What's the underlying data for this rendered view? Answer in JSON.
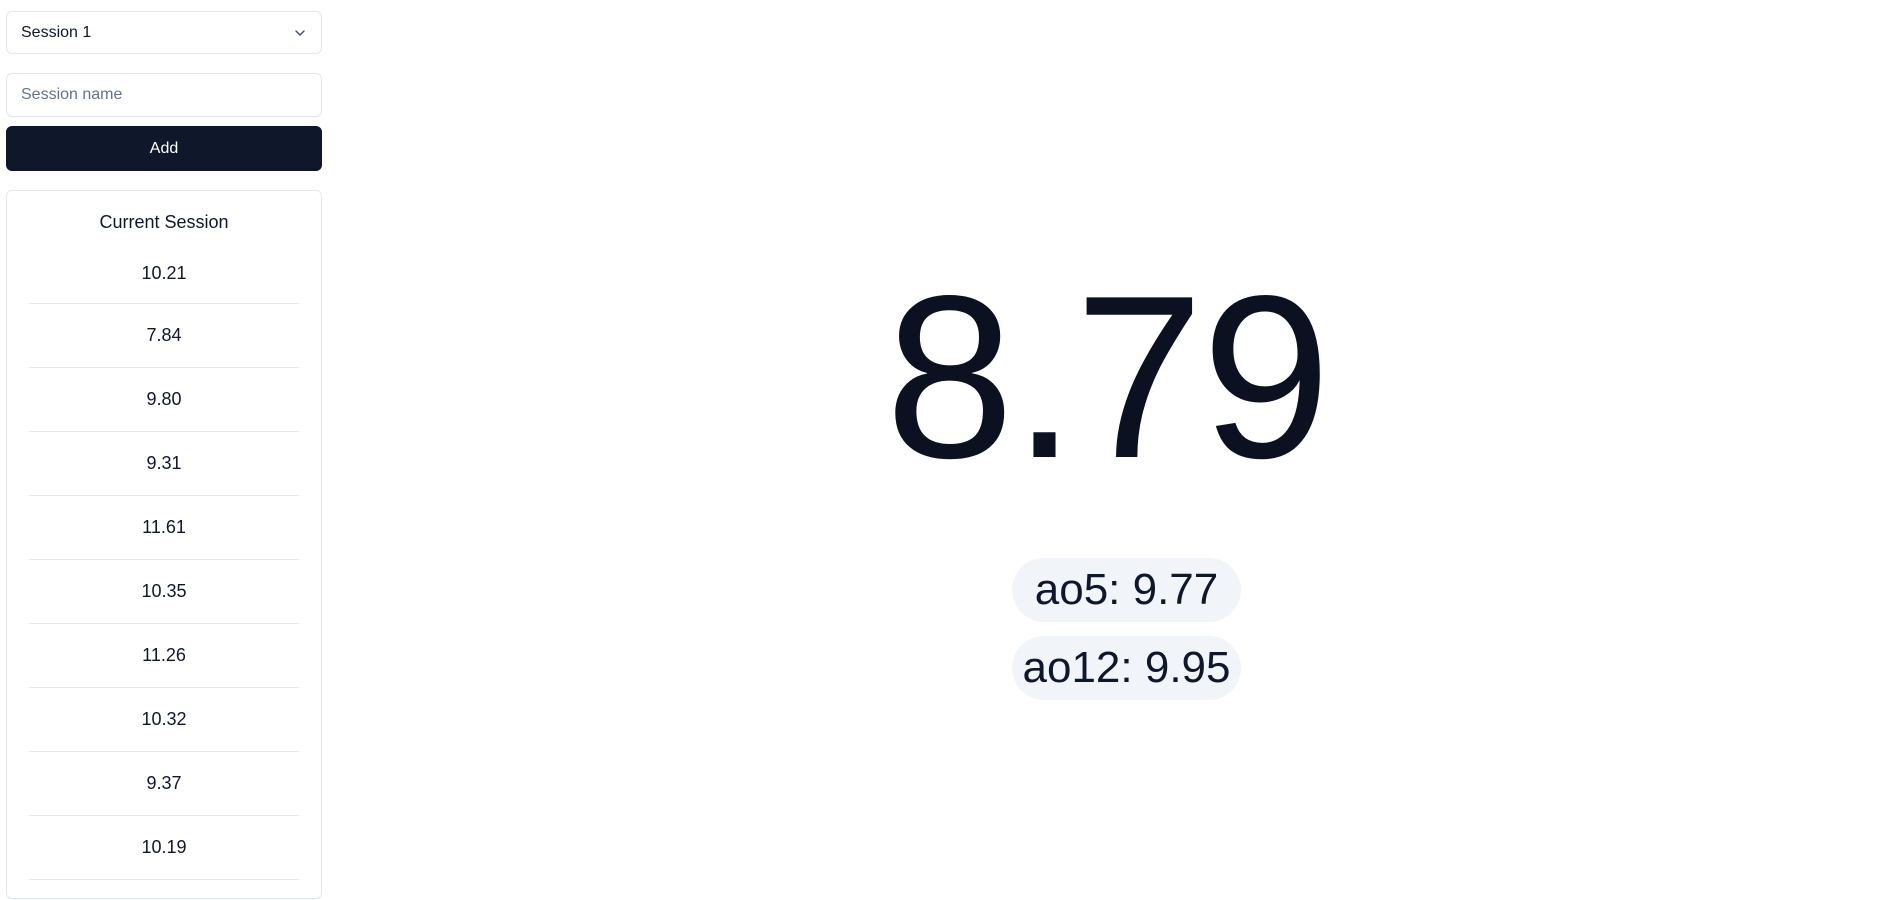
{
  "session_select": {
    "value": "Session 1"
  },
  "session_input": {
    "placeholder": "Session name",
    "value": ""
  },
  "add_button": {
    "label": "Add"
  },
  "current_session": {
    "title": "Current Session",
    "times": [
      "10.21",
      "7.84",
      "9.80",
      "9.31",
      "11.61",
      "10.35",
      "11.26",
      "10.32",
      "9.37",
      "10.19"
    ]
  },
  "timer": {
    "display": "8.79"
  },
  "stats": {
    "ao5": "ao5: 9.77",
    "ao12": "ao12: 9.95"
  }
}
